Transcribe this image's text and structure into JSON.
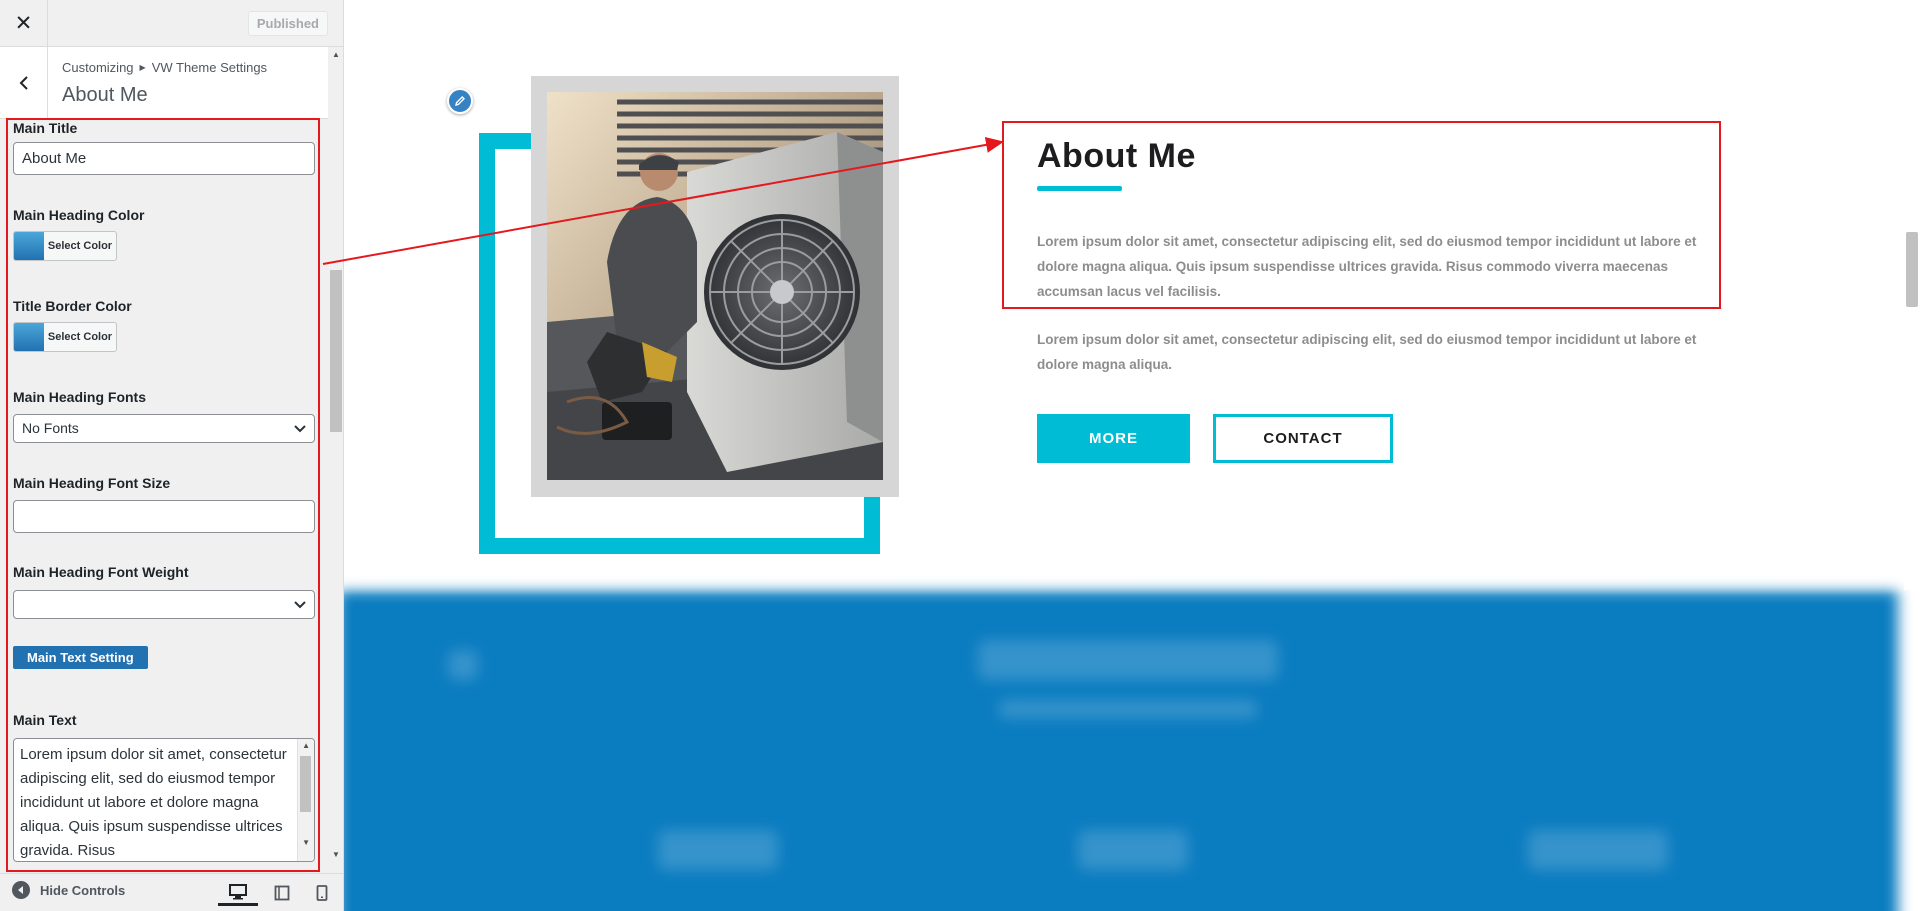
{
  "topbar": {
    "close_symbol": "✕",
    "published_label": "Published"
  },
  "section_header": {
    "breadcrumb": [
      "Customizing",
      "VW Theme Settings"
    ],
    "title": "About Me"
  },
  "controls": {
    "main_title": {
      "label": "Main Title",
      "value": "About Me"
    },
    "main_heading_color": {
      "label": "Main Heading Color",
      "button": "Select Color",
      "swatch": "#2f8fcb"
    },
    "title_border_color": {
      "label": "Title Border Color",
      "button": "Select Color",
      "swatch": "#2f8fcb"
    },
    "main_heading_fonts": {
      "label": "Main Heading Fonts",
      "value": "No Fonts"
    },
    "main_heading_font_size": {
      "label": "Main Heading Font Size",
      "value": ""
    },
    "main_heading_font_weight": {
      "label": "Main Heading Font Weight",
      "value": ""
    },
    "main_text_setting": {
      "label": "Main Text Setting"
    },
    "main_text": {
      "label": "Main Text",
      "value": "Lorem ipsum dolor sit amet, consectetur adipiscing elit, sed do eiusmod tempor incididunt ut labore et dolore magna aliqua. Quis ipsum suspendisse ultrices gravida. Risus"
    }
  },
  "footer": {
    "hide_controls": "Hide Controls",
    "devices": [
      "desktop",
      "tablet",
      "mobile"
    ],
    "active_device": "desktop"
  },
  "preview": {
    "heading": "About Me",
    "paragraph_1": "Lorem ipsum dolor sit amet, consectetur adipiscing elit, sed do eiusmod tempor incididunt ut labore et dolore magna aliqua. Quis ipsum suspendisse ultrices gravida. Risus commodo viverra maecenas accumsan lacus vel facilisis.",
    "paragraph_2": "Lorem ipsum dolor sit amet, consectetur adipiscing elit, sed do eiusmod tempor incididunt ut labore et dolore magna aliqua.",
    "more_button": "MORE",
    "contact_button": "CONTACT",
    "image": "hvac-technician-photo"
  },
  "colors": {
    "accent_cyan": "#00bcd4",
    "highlight_red": "#e3191e",
    "wp_blue": "#2271b1",
    "blurred_section_blue": "#0a7cc0"
  }
}
